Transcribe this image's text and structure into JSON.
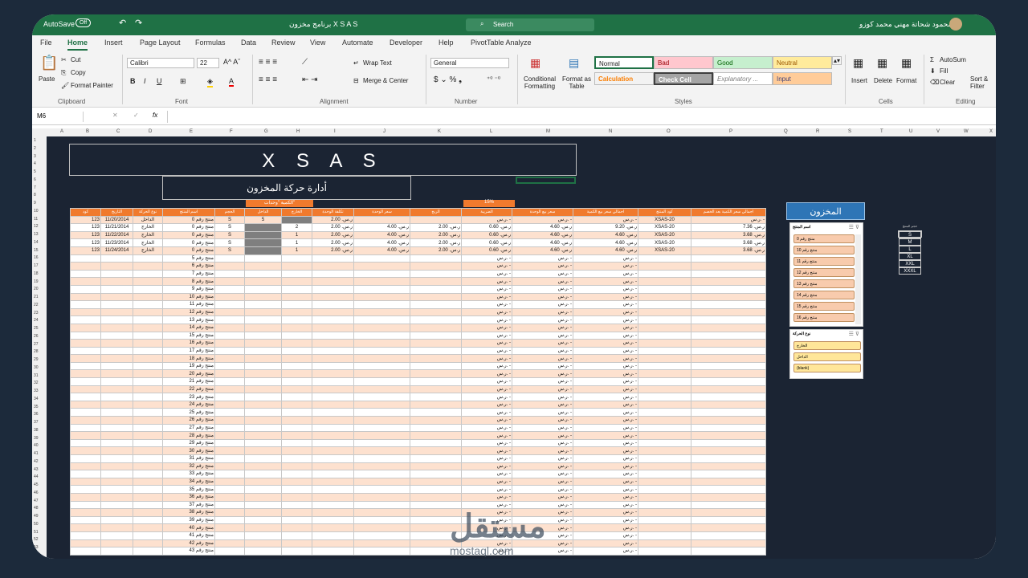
{
  "titlebar": {
    "autosave": "AutoSave",
    "toggle": "Off",
    "doc_title": "برنامج مخزون X S A S",
    "search": "Search",
    "user": "محمود شحاتة مهني محمد كوزو"
  },
  "menu": [
    "File",
    "Home",
    "Insert",
    "Page Layout",
    "Formulas",
    "Data",
    "Review",
    "View",
    "Automate",
    "Developer",
    "Help",
    "PivotTable Analyze"
  ],
  "ribbon": {
    "clipboard": {
      "paste": "Paste",
      "cut": "Cut",
      "copy": "Copy",
      "painter": "Format Painter",
      "label": "Clipboard"
    },
    "font": {
      "name": "Calibri",
      "size": "22",
      "label": "Font"
    },
    "alignment": {
      "wrap": "Wrap Text",
      "merge": "Merge & Center",
      "label": "Alignment"
    },
    "number": {
      "format": "General",
      "label": "Number"
    },
    "styles": {
      "cond": "Conditional Formatting",
      "table": "Format as Table",
      "normal": "Normal",
      "bad": "Bad",
      "good": "Good",
      "neutral": "Neutral",
      "calc": "Calculation",
      "check": "Check Cell",
      "explan": "Explanatory ...",
      "input": "Input",
      "label": "Styles"
    },
    "cells": {
      "insert": "Insert",
      "delete": "Delete",
      "format": "Format",
      "label": "Cells"
    },
    "editing": {
      "autosum": "AutoSum",
      "fill": "Fill",
      "clear": "Clear",
      "sort": "Sort & Filter",
      "label": "Editing"
    }
  },
  "formula_bar": {
    "namebox": "M6",
    "fx": "fx",
    "value": ""
  },
  "sheet": {
    "title": "X S A S",
    "subtitle": "أدارة حركة المخزون",
    "qty_header": "الكمية \"وحدات\"",
    "tax_rate": "15%",
    "headers": [
      "كود",
      "التاريخ",
      "نوع الحركة",
      "اسم المنتج",
      "الحجم",
      "الداخل",
      "الخارج",
      "تكلفة الوحدة",
      "سعر الوحدة",
      "الربح",
      "الضريبة",
      "سعر بيع الوحدة",
      "اجمالي سعر بيع الكمية",
      "كود المنتج",
      "اجمالي سعر الكمية بعد الخصم"
    ],
    "rows": [
      [
        "123",
        "11/20/2014",
        "الداخل",
        "منتج رقم 0",
        "S",
        "5",
        "",
        "ر.س. 2.00",
        "",
        "",
        "ر.س. -",
        "ر.س. -",
        "ر.س. -",
        "XSAS-20",
        "ر.س. -"
      ],
      [
        "123",
        "11/21/2014",
        "الخارج",
        "منتج رقم 0",
        "S",
        "",
        "2",
        "ر.س. 2.00",
        "ر.س. 4.00",
        "ر.س. 2.00",
        "ر.س. 0.60",
        "ر.س. 4.60",
        "ر.س. 9.20",
        "XSAS-20",
        "ر.س. 7.36"
      ],
      [
        "123",
        "11/22/2014",
        "الخارج",
        "منتج رقم 0",
        "S",
        "",
        "1",
        "ر.س. 2.00",
        "ر.س. 4.00",
        "ر.س. 2.00",
        "ر.س. 0.60",
        "ر.س. 4.60",
        "ر.س. 4.60",
        "XSAS-20",
        "ر.س. 3.68"
      ],
      [
        "123",
        "11/23/2014",
        "الخارج",
        "منتج رقم 0",
        "S",
        "",
        "1",
        "ر.س. 2.00",
        "ر.س. 4.00",
        "ر.س. 2.00",
        "ر.س. 0.60",
        "ر.س. 4.60",
        "ر.س. 4.60",
        "XSAS-20",
        "ر.س. 3.68"
      ],
      [
        "123",
        "11/24/2014",
        "الخارج",
        "منتج رقم 0",
        "S",
        "",
        "1",
        "ر.س. 2.00",
        "ر.س. 4.00",
        "ر.س. 2.00",
        "ر.س. 0.60",
        "ر.س. 4.60",
        "ر.س. 4.60",
        "XSAS-20",
        "ر.س. 3.68"
      ]
    ],
    "empty_product_prefix": "منتج رقم",
    "empty_start": 5,
    "empty_end": 43,
    "dash": "ر.س. -"
  },
  "slicer": {
    "header": "المخزون",
    "product_title": "اسم المنتج",
    "products": [
      "منتج رقم 0",
      "منتج رقم 10",
      "منتج رقم 11",
      "منتج رقم 12",
      "منتج رقم 13",
      "منتج رقم 14",
      "منتج رقم 15",
      "منتج رقم 16"
    ],
    "move_title": "نوع الحركة",
    "moves": [
      "الخارج",
      "الداخل",
      "(blank)"
    ]
  },
  "sizes": {
    "title": "حجم المنتج",
    "items": [
      "S",
      "M",
      "L",
      "XL",
      "XXL",
      "XXXL"
    ]
  },
  "watermark": {
    "logo": "مستقل",
    "url": "mostaql.com"
  }
}
